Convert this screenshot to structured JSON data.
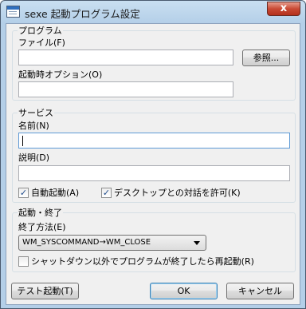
{
  "window": {
    "title": "sexe 起動プログラム設定",
    "close_symbol": "x"
  },
  "program_group": {
    "title": "プログラム",
    "file_label": "ファイル(F)",
    "file_value": "",
    "browse_button": "参照...",
    "options_label": "起動時オプション(O)",
    "options_value": ""
  },
  "service_group": {
    "title": "サービス",
    "name_label": "名前(N)",
    "name_value": "",
    "description_label": "説明(D)",
    "description_value": "",
    "auto_start": {
      "label": "自動起動(A)",
      "checked": true
    },
    "desktop_interact": {
      "label": "デスクトップとの対話を許可(K)",
      "checked": true
    }
  },
  "startstop_group": {
    "title": "起動・終了",
    "stop_method_label": "終了方法(E)",
    "stop_method_selected": "WM_SYSCOMMAND→WM_CLOSE",
    "restart": {
      "label": "シャットダウン以外でプログラムが終了したら再起動(R)",
      "checked": false
    }
  },
  "buttons": {
    "test_start": "テスト起動(T)",
    "ok": "OK",
    "cancel": "キャンセル"
  },
  "check_mark": "✓"
}
